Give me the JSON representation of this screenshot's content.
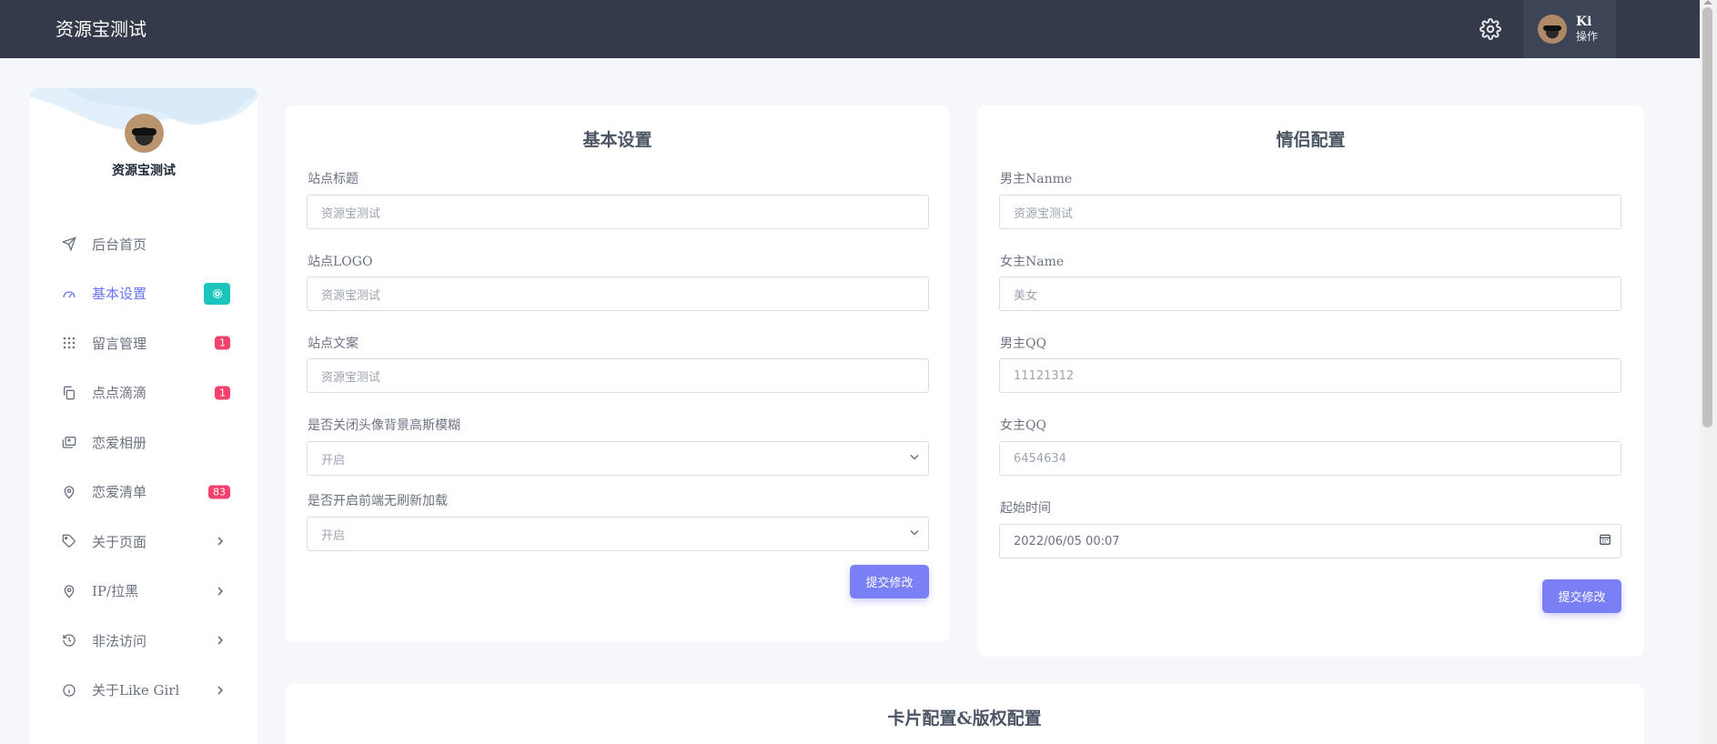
{
  "app": {
    "brand": "资源宝测试"
  },
  "header": {
    "user_name": "Ki",
    "user_role": "操作"
  },
  "sidebar": {
    "title": "资源宝测试",
    "items": [
      {
        "label": "后台首页",
        "icon": "send-icon"
      },
      {
        "label": "基本设置",
        "icon": "gauge-icon",
        "active": true
      },
      {
        "label": "留言管理",
        "icon": "grid-dots-icon",
        "badge": "1"
      },
      {
        "label": "点点滴滴",
        "icon": "copy-icon",
        "badge": "1"
      },
      {
        "label": "恋爱相册",
        "icon": "photos-icon"
      },
      {
        "label": "恋爱清单",
        "icon": "map-pin-icon",
        "badge": "83"
      },
      {
        "label": "关于页面",
        "icon": "tag-icon"
      },
      {
        "label": "IP/拉黑",
        "icon": "map-pin-icon"
      },
      {
        "label": "非法访问",
        "icon": "history-icon"
      },
      {
        "label": "关于Like Girl",
        "icon": "info-icon"
      }
    ]
  },
  "basic": {
    "title": "基本设置",
    "site_title_label": "站点标题",
    "site_title_placeholder": "资源宝测试",
    "site_logo_label": "站点LOGO",
    "site_logo_placeholder": "资源宝测试",
    "site_copy_label": "站点文案",
    "site_copy_placeholder": "资源宝测试",
    "blur_label": "是否关闭头像背景高斯模糊",
    "blur_value": "开启",
    "refresh_label": "是否开启前端无刷新加载",
    "refresh_value": "开启",
    "submit": "提交修改"
  },
  "couple": {
    "title": "情侣配置",
    "male_name_label": "男主Nanme",
    "male_name_placeholder": "资源宝测试",
    "female_name_label": "女主Name",
    "female_name_placeholder": "美女",
    "male_qq_label": "男主QQ",
    "male_qq_placeholder": "11121312",
    "female_qq_label": "女主QQ",
    "female_qq_placeholder": "6454634",
    "start_label": "起始时间",
    "start_value": "2022/06/05 00:07",
    "submit": "提交修改"
  },
  "card3": {
    "title": "卡片配置&版权配置"
  },
  "colors": {
    "accent": "#6875f5",
    "danger": "#f1416c",
    "success": "#1bc5bd",
    "topbar": "#343a4a"
  }
}
